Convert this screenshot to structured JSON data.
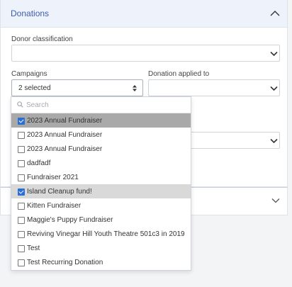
{
  "section": {
    "title": "Donations"
  },
  "fields": {
    "donor_classification": {
      "label": "Donor classification",
      "value": ""
    },
    "campaigns": {
      "label": "Campaigns",
      "value": "2 selected"
    },
    "donation_applied_to": {
      "label": "Donation applied to",
      "value": ""
    }
  },
  "campaign_dropdown": {
    "search_placeholder": "Search",
    "options": [
      {
        "label": "2023 Annual Fundraiser",
        "checked": true,
        "highlight": "dark"
      },
      {
        "label": "2023 Annual Fundraiser",
        "checked": false,
        "highlight": "none"
      },
      {
        "label": "2023 Annual Fundraiser",
        "checked": false,
        "highlight": "none"
      },
      {
        "label": "dadfadf",
        "checked": false,
        "highlight": "none"
      },
      {
        "label": "Fundraiser 2021",
        "checked": false,
        "highlight": "none"
      },
      {
        "label": "Island Cleanup fund!",
        "checked": true,
        "highlight": "light"
      },
      {
        "label": "Kitten Fundraiser",
        "checked": false,
        "highlight": "none"
      },
      {
        "label": "Maggie's Puppy Fundraiser",
        "checked": false,
        "highlight": "none"
      },
      {
        "label": "Reviving Vinegar Hill Youth Theatre 501c3 in 2019",
        "checked": false,
        "highlight": "none"
      },
      {
        "label": "Test",
        "checked": false,
        "highlight": "none"
      },
      {
        "label": "Test Recurring Donation",
        "checked": false,
        "highlight": "none"
      }
    ]
  },
  "colors": {
    "header_bg": "#eef2fb",
    "title": "#3f5bb0",
    "check": "#2b6fd6"
  },
  "icons": {
    "collapse": "chevron-up-icon",
    "expand": "chevron-down-icon",
    "select_arrow": "chevron-down-icon",
    "sort": "sort-updown-icon",
    "search": "search-icon"
  }
}
